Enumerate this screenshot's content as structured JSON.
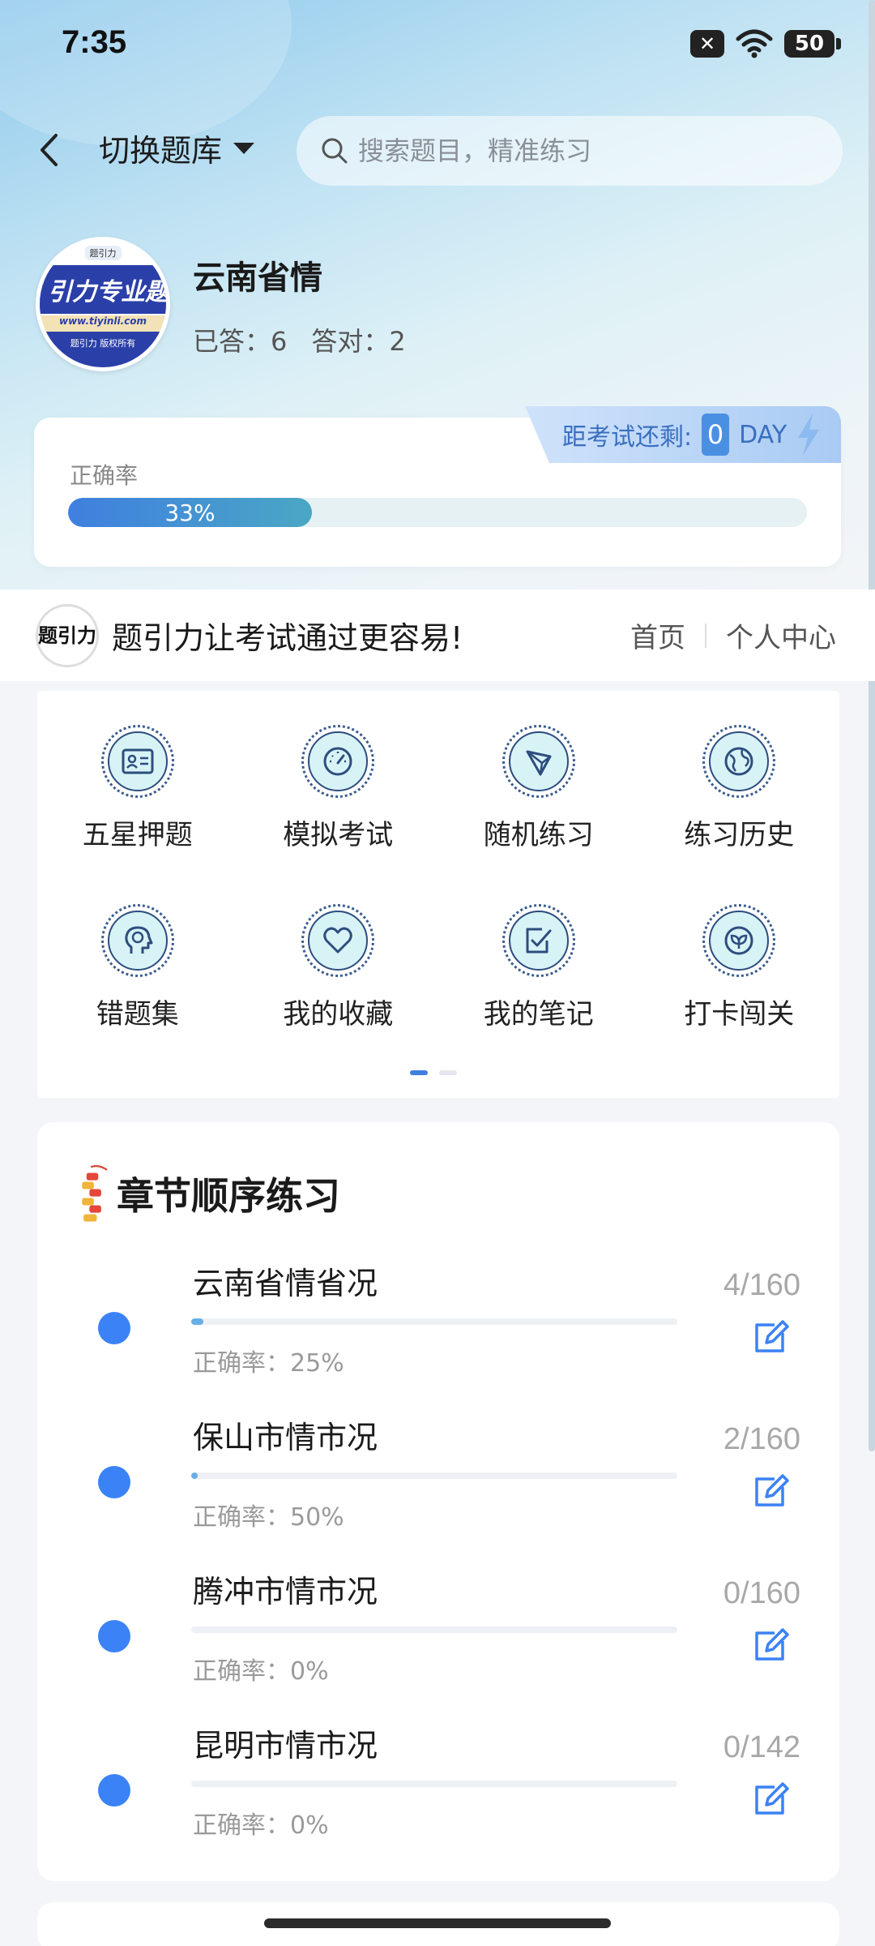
{
  "status_bar": {
    "time": "7:35",
    "battery": "50"
  },
  "header": {
    "switch_label": "切换题库",
    "search_placeholder": "搜索题目，精准练习"
  },
  "profile": {
    "avatar": {
      "top_text": "题引力",
      "banner_text": "引力专业题",
      "url": "www.tiyinli.com",
      "bottom_text": "题引力 版权所有"
    },
    "subject": "云南省情",
    "answered_label": "已答：6",
    "correct_label": "答对：2"
  },
  "accuracy": {
    "label": "正确率",
    "percent_text": "33%",
    "value": 0.33,
    "countdown_label": "距考试还剩:",
    "countdown_value": "0",
    "countdown_unit": "DAY"
  },
  "promo": {
    "logo_text": "题引力",
    "slogan": "题引力让考试通过更容易!",
    "link_home": "首页",
    "link_profile": "个人中心"
  },
  "grid": {
    "items": [
      {
        "label": "五星押题",
        "icon": "id-card-icon"
      },
      {
        "label": "模拟考试",
        "icon": "speedometer-icon"
      },
      {
        "label": "随机练习",
        "icon": "random-network-icon"
      },
      {
        "label": "练习历史",
        "icon": "globe-icon"
      },
      {
        "label": "错题集",
        "icon": "head-brain-icon"
      },
      {
        "label": "我的收藏",
        "icon": "heart-icon"
      },
      {
        "label": "我的笔记",
        "icon": "note-check-icon"
      },
      {
        "label": "打卡闯关",
        "icon": "leaf-badge-icon"
      }
    ],
    "page_count": 2,
    "current_page": 1
  },
  "chapters": {
    "title": "章节顺序练习",
    "items": [
      {
        "name": "云南省情省况",
        "accuracy": "正确率：25%",
        "count": "4/160",
        "progress": 0.025
      },
      {
        "name": "保山市情市况",
        "accuracy": "正确率：50%",
        "count": "2/160",
        "progress": 0.0125
      },
      {
        "name": "腾冲市情市况",
        "accuracy": "正确率：0%",
        "count": "0/160",
        "progress": 0
      },
      {
        "name": "昆明市情市况",
        "accuracy": "正确率：0%",
        "count": "0/142",
        "progress": 0
      }
    ]
  },
  "colors": {
    "accent": "#3b82f6",
    "bar_start": "#3f7fe0",
    "bar_end": "#4aa7c4"
  }
}
